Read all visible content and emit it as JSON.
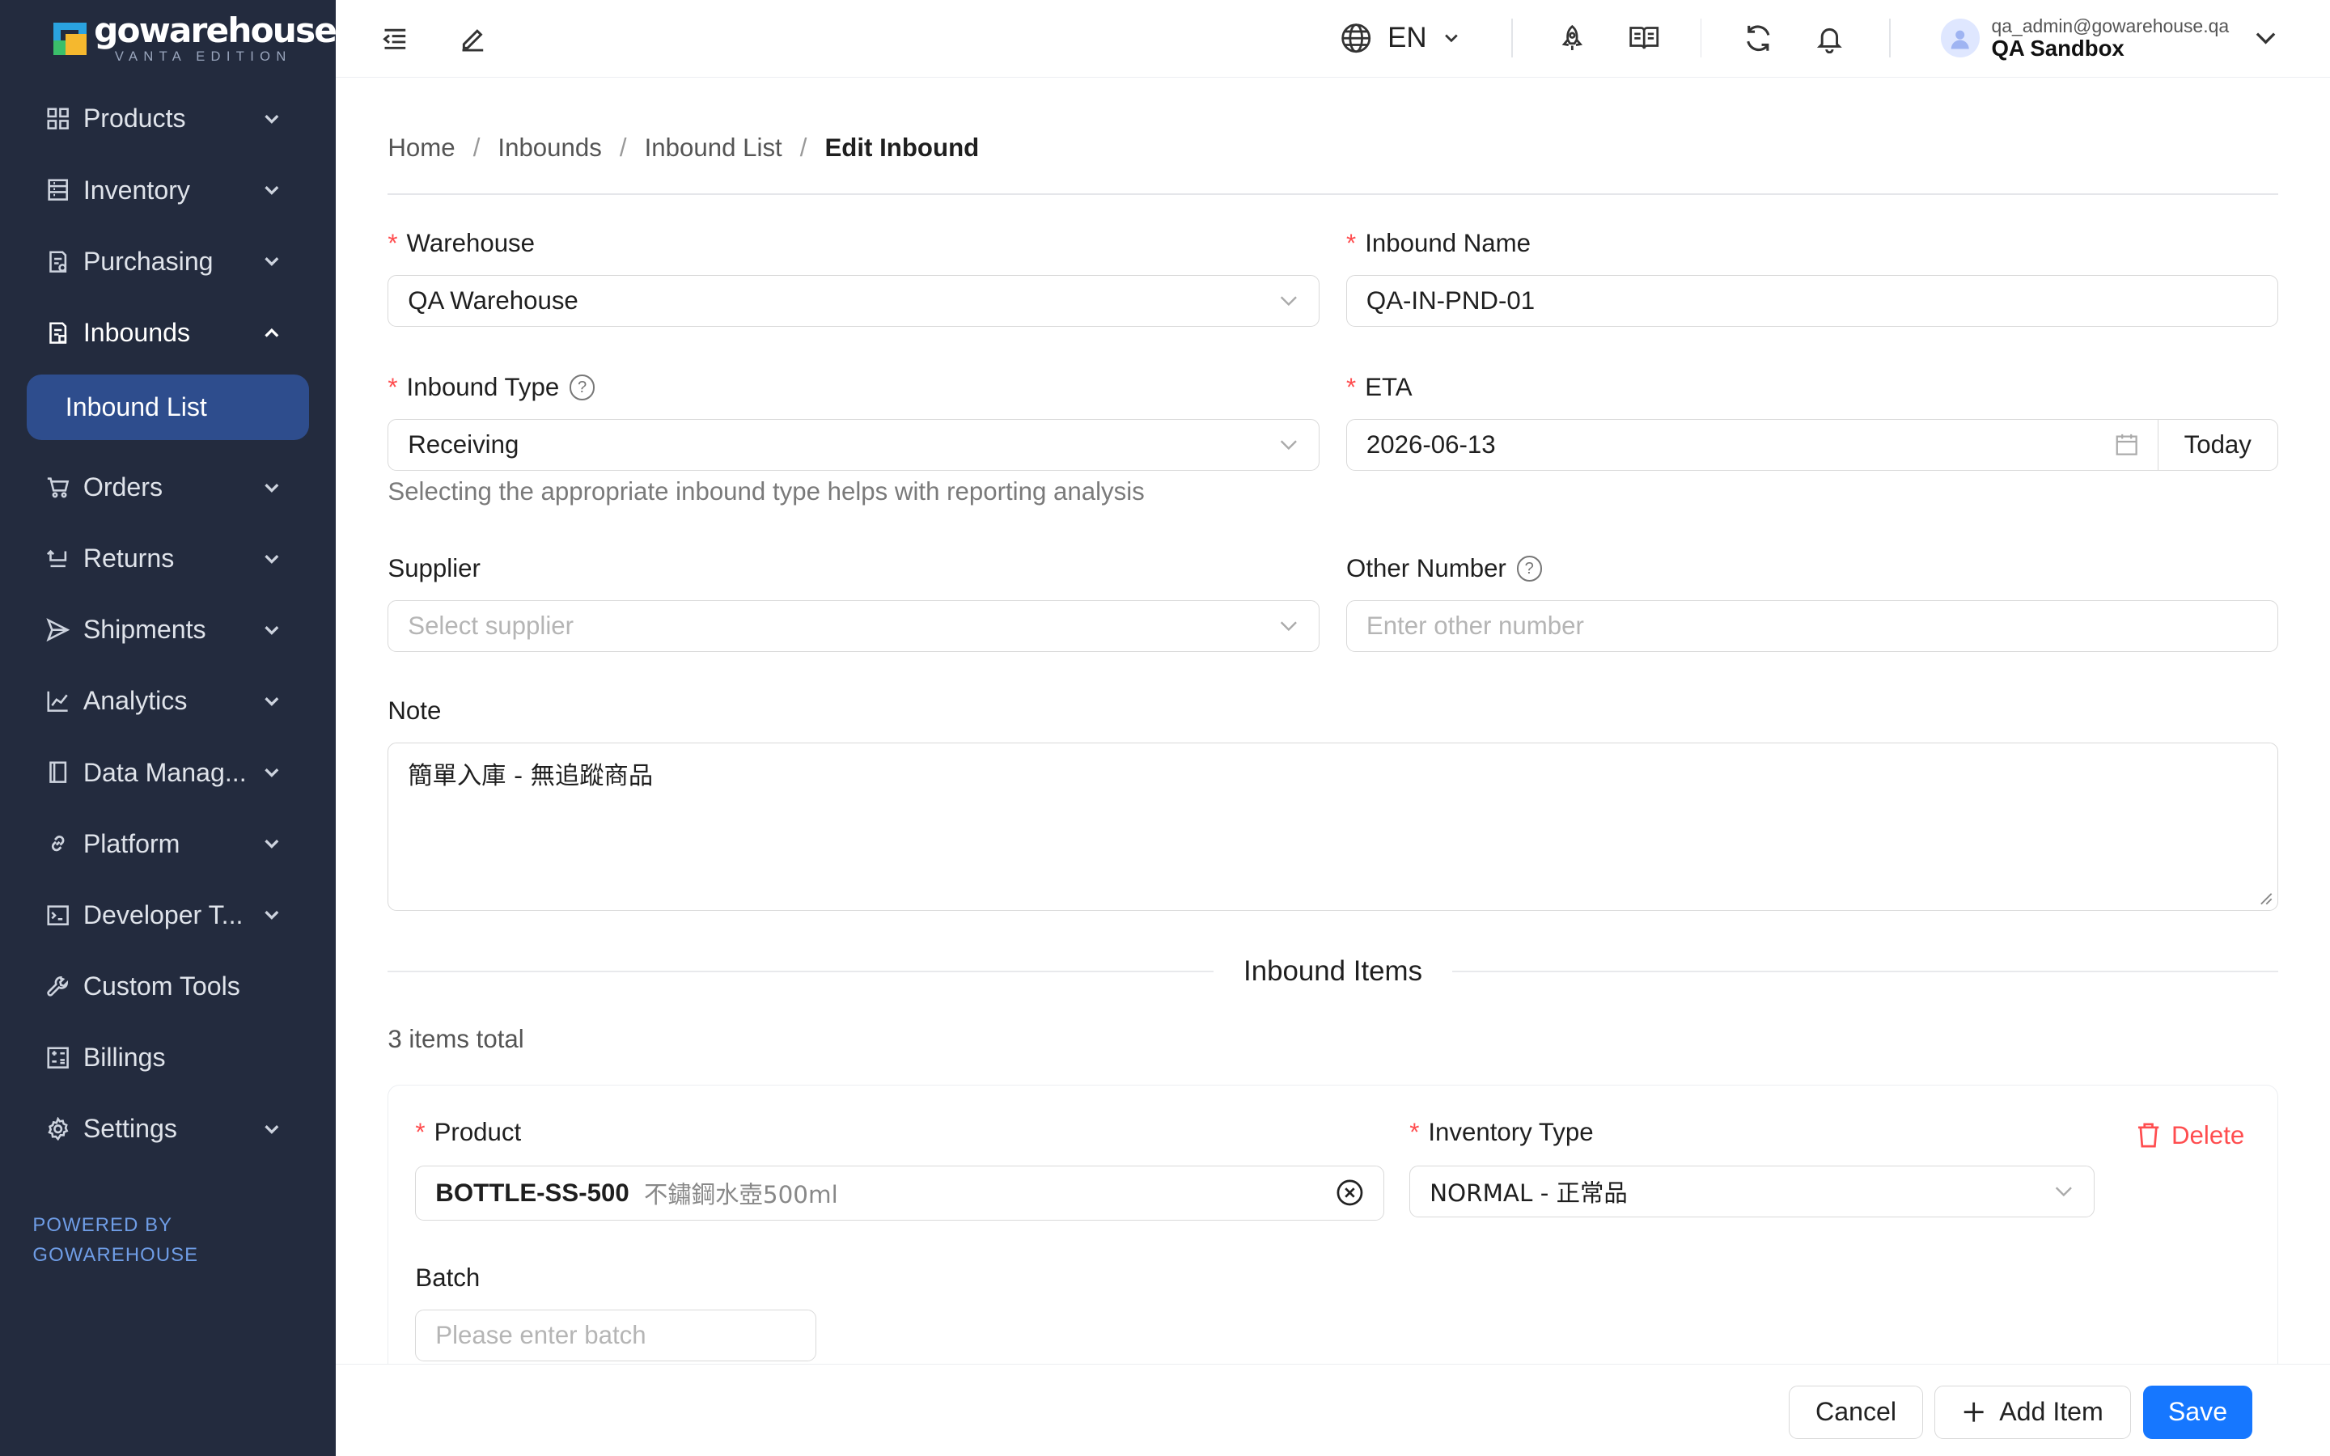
{
  "brand": {
    "name": "gowarehouse",
    "edition": "VANTA EDITION",
    "powered_line1": "POWERED BY",
    "powered_line2": "GOWAREHOUSE"
  },
  "sidebar": {
    "items": [
      {
        "label": "Products",
        "icon": "grid-icon"
      },
      {
        "label": "Inventory",
        "icon": "inventory-icon"
      },
      {
        "label": "Purchasing",
        "icon": "purchasing-icon"
      },
      {
        "label": "Inbounds",
        "icon": "inbounds-icon"
      },
      {
        "label": "Orders",
        "icon": "cart-icon"
      },
      {
        "label": "Returns",
        "icon": "return-icon"
      },
      {
        "label": "Shipments",
        "icon": "send-icon"
      },
      {
        "label": "Analytics",
        "icon": "chart-icon"
      },
      {
        "label": "Data Manag...",
        "icon": "book-icon"
      },
      {
        "label": "Platform",
        "icon": "link-icon"
      },
      {
        "label": "Developer T...",
        "icon": "terminal-icon"
      },
      {
        "label": "Custom Tools",
        "icon": "wrench-icon"
      },
      {
        "label": "Billings",
        "icon": "calculator-icon"
      },
      {
        "label": "Settings",
        "icon": "gear-icon"
      }
    ],
    "active_sub": "Inbound List"
  },
  "topbar": {
    "lang": "EN",
    "user_email": "qa_admin@gowarehouse.qa",
    "user_name": "QA Sandbox"
  },
  "breadcrumb": [
    "Home",
    "Inbounds",
    "Inbound List",
    "Edit Inbound"
  ],
  "form": {
    "warehouse_label": "Warehouse",
    "warehouse_value": "QA Warehouse",
    "inbound_name_label": "Inbound Name",
    "inbound_name_value": "QA-IN-PND-01",
    "inbound_type_label": "Inbound Type",
    "inbound_type_value": "Receiving",
    "inbound_type_help": "Selecting the appropriate inbound type helps with reporting analysis",
    "eta_label": "ETA",
    "eta_value": "2026-06-13",
    "today_label": "Today",
    "supplier_label": "Supplier",
    "supplier_placeholder": "Select supplier",
    "other_number_label": "Other Number",
    "other_number_placeholder": "Enter other number",
    "note_label": "Note",
    "note_value": "簡單入庫 - 無追蹤商品"
  },
  "items_section": {
    "title": "Inbound Items",
    "count_text": "3 items total",
    "item": {
      "product_label": "Product",
      "product_code": "BOTTLE-SS-500",
      "product_desc": "不鏽鋼水壺500ml",
      "inventory_type_label": "Inventory Type",
      "inventory_type_value": "NORMAL - 正常品",
      "batch_label": "Batch",
      "batch_placeholder": "Please enter batch",
      "delete_label": "Delete"
    }
  },
  "footer": {
    "cancel": "Cancel",
    "add_item": "Add Item",
    "save": "Save"
  },
  "colors": {
    "sidebar_bg": "#232b3e",
    "active_bg": "#2e4d8d",
    "primary": "#1677ff",
    "danger": "#ff4d4f"
  }
}
